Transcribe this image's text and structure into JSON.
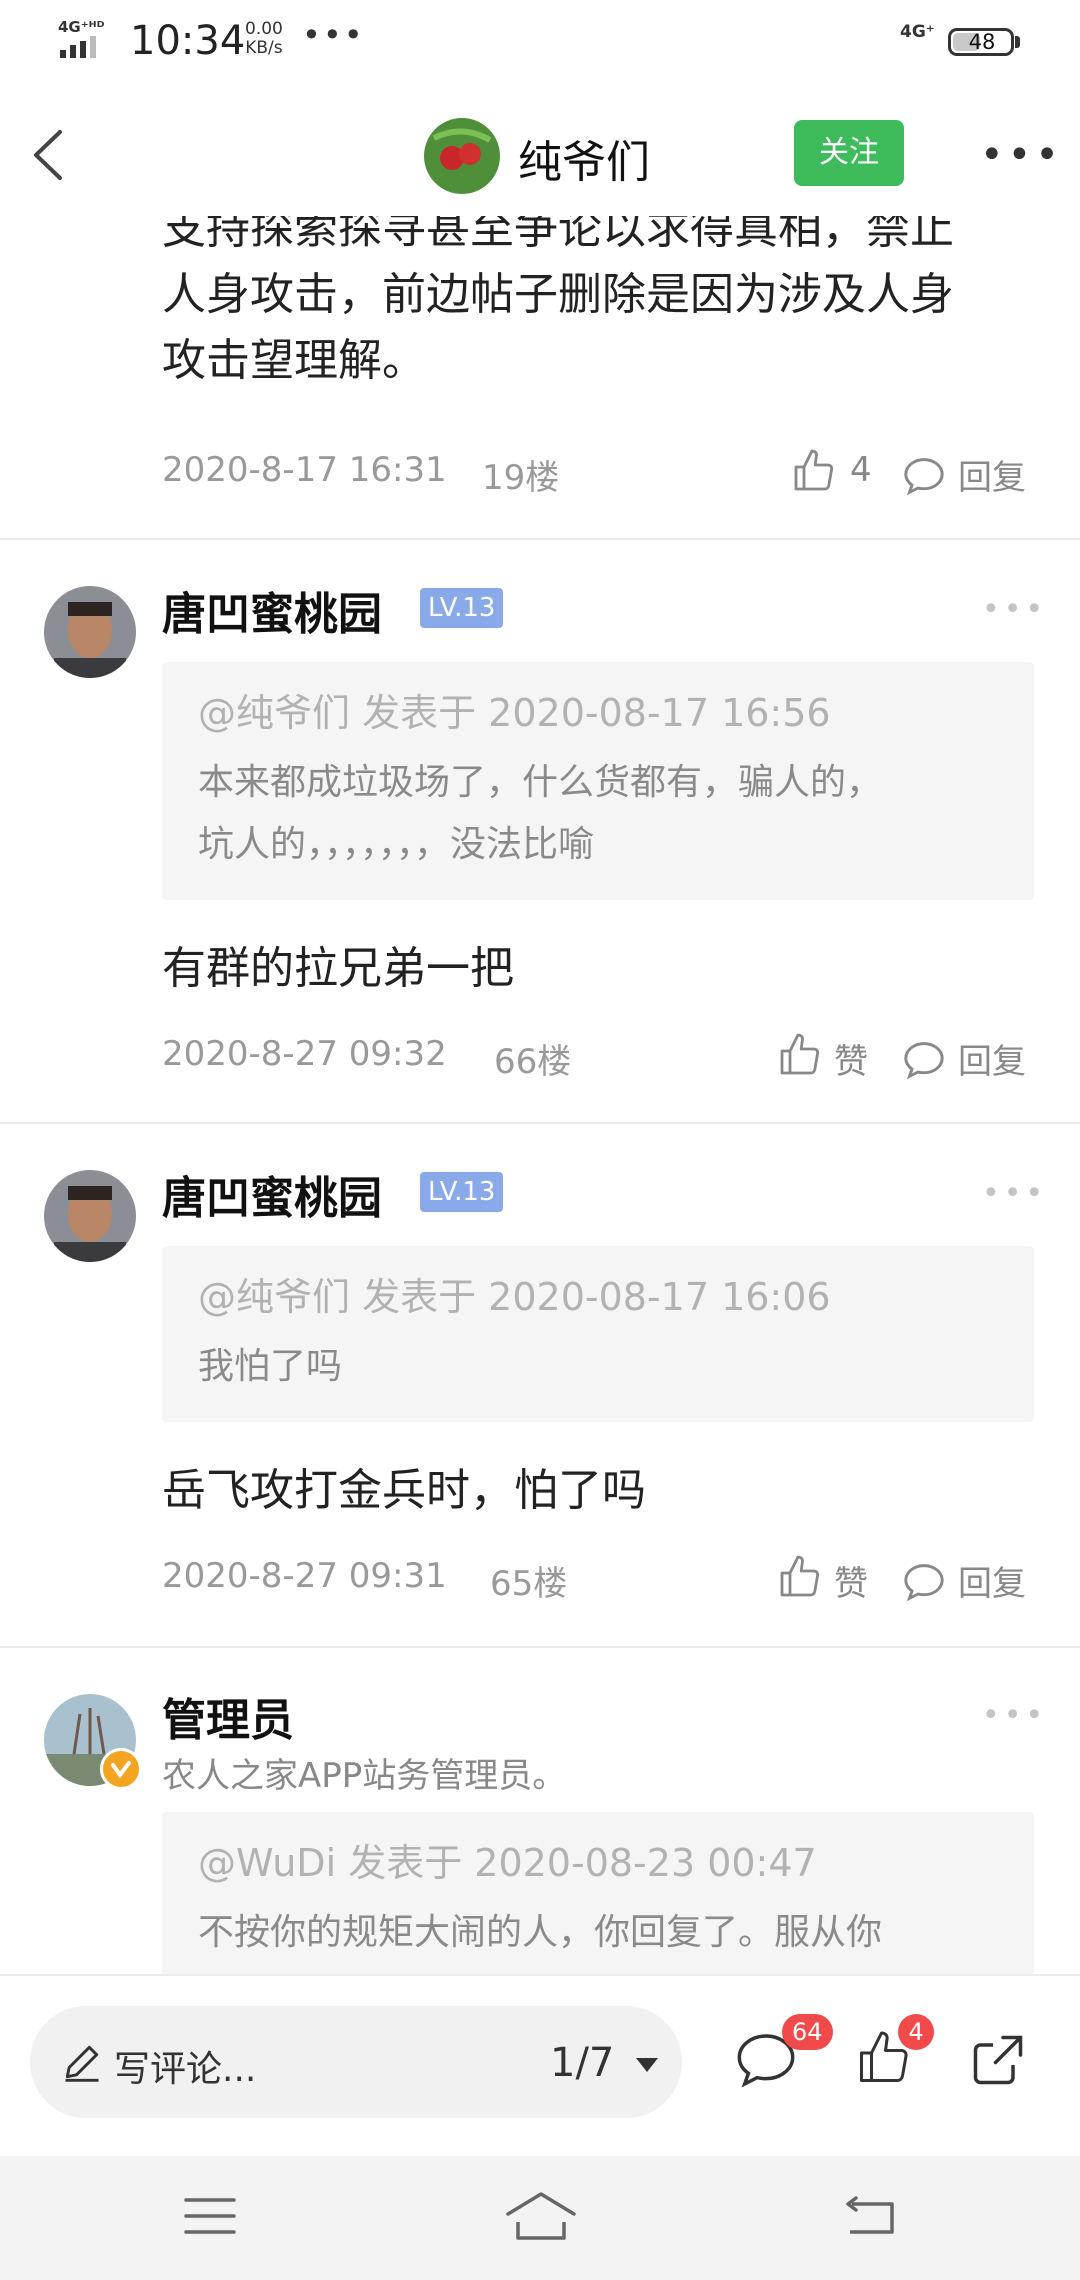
{
  "status_bar": {
    "network": "4G⁺ᴴᴰ",
    "time": "10:34",
    "speed_value": "0.00",
    "speed_unit": "KB/s",
    "dots": "•••",
    "network_right": "4G⁺",
    "battery": "48"
  },
  "header": {
    "title": "纯爷们",
    "follow_label": "关注"
  },
  "posts": [
    {
      "text_lines": [
        "支持探索探寻甚至争论以求得真相，禁止",
        "人身攻击，前边帖子删除是因为涉及人身",
        "攻击望理解。"
      ],
      "date": "2020-8-17 16:31",
      "floor": "19楼",
      "like_label": "4",
      "reply_label": "回复"
    },
    {
      "username": "唐凹蜜桃园",
      "level": "LV.13",
      "quote_head": "@纯爷们 发表于 2020-08-17 16:56",
      "quote_lines": [
        "本来都成垃圾场了，什么货都有，骗人的，",
        "坑人的，，，，，，，没法比喻"
      ],
      "text": "有群的拉兄弟一把",
      "date": "2020-8-27 09:32",
      "floor": "66楼",
      "like_label": "赞",
      "reply_label": "回复"
    },
    {
      "username": "唐凹蜜桃园",
      "level": "LV.13",
      "quote_head": "@纯爷们 发表于 2020-08-17 16:06",
      "quote_lines": [
        "我怕了吗"
      ],
      "text": "岳飞攻打金兵时，怕了吗",
      "date": "2020-8-27 09:31",
      "floor": "65楼",
      "like_label": "赞",
      "reply_label": "回复"
    },
    {
      "username": "管理员",
      "subtitle": "农人之家APP站务管理员。",
      "quote_head": "@WuDi 发表于 2020-08-23 00:47",
      "quote_lines": [
        "不按你的规矩大闹的人，你回复了。服从你"
      ]
    }
  ],
  "bottom_bar": {
    "comment_placeholder": "写评论...",
    "page": "1/7",
    "comment_count": "64",
    "like_count": "4"
  },
  "colors": {
    "accent_green": "#3ebb5a",
    "level_badge": "#8aa9e8",
    "badge_red": "#f04a4a"
  }
}
